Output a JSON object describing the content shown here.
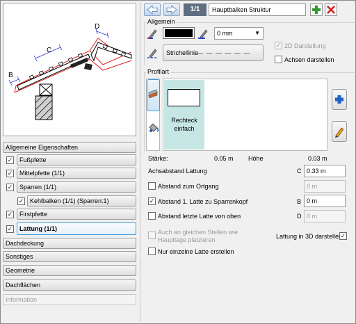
{
  "toolbar": {
    "counter": "1/1",
    "name": "Hauptbalken Struktur"
  },
  "allgemein": {
    "title": "Allgemein",
    "line_width": "0 mm",
    "line_style_label": "Strichellinie",
    "line_style_pattern": "— — — — — —",
    "darstellung_2d": "2D Darstellung",
    "achsen_darstellen": "Achsen darstellen"
  },
  "profilart": {
    "title": "Profilart",
    "profile_label": "Rechteck einfach",
    "staerke_label": "Stärke:",
    "staerke_value": "0.05 m",
    "hoehe_label": "Höhe",
    "hoehe_value": "0.03 m"
  },
  "form": {
    "achsabstand_label": "Achsabstand Lattung",
    "achsabstand_letter": "C",
    "achsabstand_value": "0.33 m",
    "abstand_ortgang_label": "Abstand zum Ortgang",
    "abstand_ortgang_value": "0 m",
    "abstand_erste_label": "Abstand 1. Latte zu Sparrenkopf",
    "abstand_erste_letter": "B",
    "abstand_erste_value": "0 m",
    "abstand_letzte_label": "Abstand letzte Latte von oben",
    "abstand_letzte_letter": "D",
    "abstand_letzte_value": "0 m",
    "hauptlage_label_1": "Auch an gleichen Stellen wie",
    "hauptlage_label_2": "Hauptlage platzieren",
    "lattung_3d_label": "Lattung in 3D darstellen",
    "nur_einzelne_label": "Nur einzelne Latte erstellen"
  },
  "preview": {
    "letters": [
      "B",
      "C",
      "D"
    ]
  },
  "nav": {
    "items": [
      {
        "label": "Allgemeine Eigenschaften"
      },
      {
        "label": "Fußpfette"
      },
      {
        "label": "Mittelpfette (1/1)"
      },
      {
        "label": "Sparren (1/1)"
      },
      {
        "label": "Kehlbalken (1/1) (Sparren:1)"
      },
      {
        "label": "Firstpfette"
      },
      {
        "label": "Lattung (1/1)"
      },
      {
        "label": "Dachdeckung"
      },
      {
        "label": "Sonstiges"
      },
      {
        "label": "Geometrie"
      },
      {
        "label": "Dachflächen"
      },
      {
        "label": "Information"
      }
    ]
  },
  "icons": {
    "back": "arrow-left-icon",
    "forward": "arrow-right-icon",
    "add": "plus-icon",
    "delete": "close-icon",
    "color": "pen-color-icon",
    "width": "pen-width-icon",
    "style": "pen-style-icon",
    "profile_material": "profile-material-icon",
    "profile_fill": "fill-bucket-icon",
    "profile_add": "plus-icon",
    "profile_edit": "pencil-icon"
  },
  "colors": {
    "accent_blue": "#3c9ad8",
    "add_green": "#2e9a2e",
    "delete_red": "#d02020",
    "profile_selected_bg": "#c6e6e3",
    "counter_bg": "#5e6e80"
  }
}
